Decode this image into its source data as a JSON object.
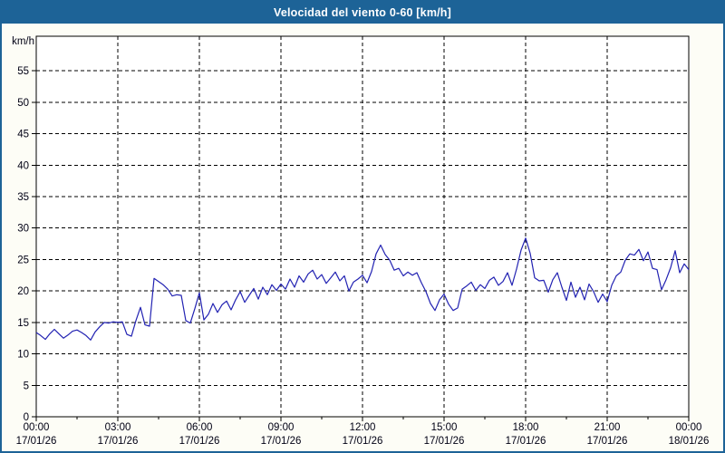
{
  "header": {
    "title": "Velocidad del viento 0-60 [km/h]"
  },
  "colors": {
    "header_bg": "#1d6397",
    "header_text": "#ffffff",
    "page_bg": "#fdfdf6",
    "plot_bg": "#ffffff",
    "plot_border": "#000000",
    "grid": "#000000",
    "axis_text": "#000014",
    "line": "#2222b2",
    "frame_border": "#1d6397"
  },
  "chart_data": {
    "type": "line",
    "title": "Velocidad del viento 0-60 [km/h]",
    "ylabel": "km/h",
    "xlabel": "",
    "ylim": [
      0,
      60.5
    ],
    "yticks": [
      0,
      5,
      10,
      15,
      20,
      25,
      30,
      35,
      40,
      45,
      50,
      55
    ],
    "x_hours_span": 24,
    "x_major_tick_hours": 3,
    "x_minor_tick_hours": 1.5,
    "xtick_labels": [
      {
        "time": "00:00",
        "date": "17/01/26"
      },
      {
        "time": "03:00",
        "date": "17/01/26"
      },
      {
        "time": "06:00",
        "date": "17/01/26"
      },
      {
        "time": "09:00",
        "date": "17/01/26"
      },
      {
        "time": "12:00",
        "date": "17/01/26"
      },
      {
        "time": "15:00",
        "date": "17/01/26"
      },
      {
        "time": "18:00",
        "date": "17/01/26"
      },
      {
        "time": "21:00",
        "date": "17/01/26"
      },
      {
        "time": "00:00",
        "date": "18/01/26"
      }
    ],
    "grid": "dashed",
    "legend_position": "none",
    "sample_interval_minutes": 10,
    "series": [
      {
        "name": "Velocidad del viento",
        "color": "#2222b2",
        "values": [
          13.4,
          12.9,
          12.3,
          13.2,
          13.9,
          13.2,
          12.5,
          13.0,
          13.6,
          13.8,
          13.4,
          12.9,
          12.2,
          13.5,
          14.3,
          15.0,
          14.9,
          15.1,
          15.0,
          15.1,
          13.1,
          12.8,
          15.3,
          17.4,
          14.6,
          14.4,
          22.0,
          21.5,
          21.0,
          20.3,
          19.2,
          19.4,
          19.3,
          15.3,
          14.9,
          17.2,
          19.7,
          15.4,
          16.3,
          18.0,
          16.6,
          17.8,
          18.4,
          17.0,
          18.6,
          19.9,
          18.2,
          19.3,
          20.4,
          18.7,
          20.6,
          19.4,
          21.0,
          20.1,
          21.1,
          20.3,
          21.9,
          20.6,
          22.4,
          21.4,
          22.7,
          23.3,
          21.9,
          22.6,
          21.2,
          22.1,
          23.0,
          21.6,
          22.4,
          20.0,
          21.4,
          21.9,
          22.5,
          21.3,
          23.1,
          25.9,
          27.3,
          25.8,
          24.9,
          23.3,
          23.6,
          22.4,
          23.0,
          22.5,
          22.9,
          21.3,
          19.9,
          18.0,
          16.9,
          18.6,
          19.5,
          17.9,
          16.9,
          17.3,
          20.3,
          20.8,
          21.4,
          20.1,
          21.0,
          20.4,
          21.7,
          22.2,
          20.9,
          21.5,
          22.9,
          20.9,
          23.5,
          26.5,
          28.4,
          26.0,
          22.1,
          21.6,
          21.7,
          19.8,
          21.8,
          22.9,
          20.6,
          18.5,
          21.4,
          19.0,
          20.6,
          18.6,
          21.1,
          19.9,
          18.2,
          19.5,
          18.3,
          20.9,
          22.4,
          23.0,
          24.9,
          25.9,
          25.7,
          26.6,
          24.8,
          26.2,
          23.6,
          23.4,
          20.2,
          21.8,
          23.7,
          26.4,
          22.9,
          24.3,
          23.4
        ]
      }
    ]
  }
}
